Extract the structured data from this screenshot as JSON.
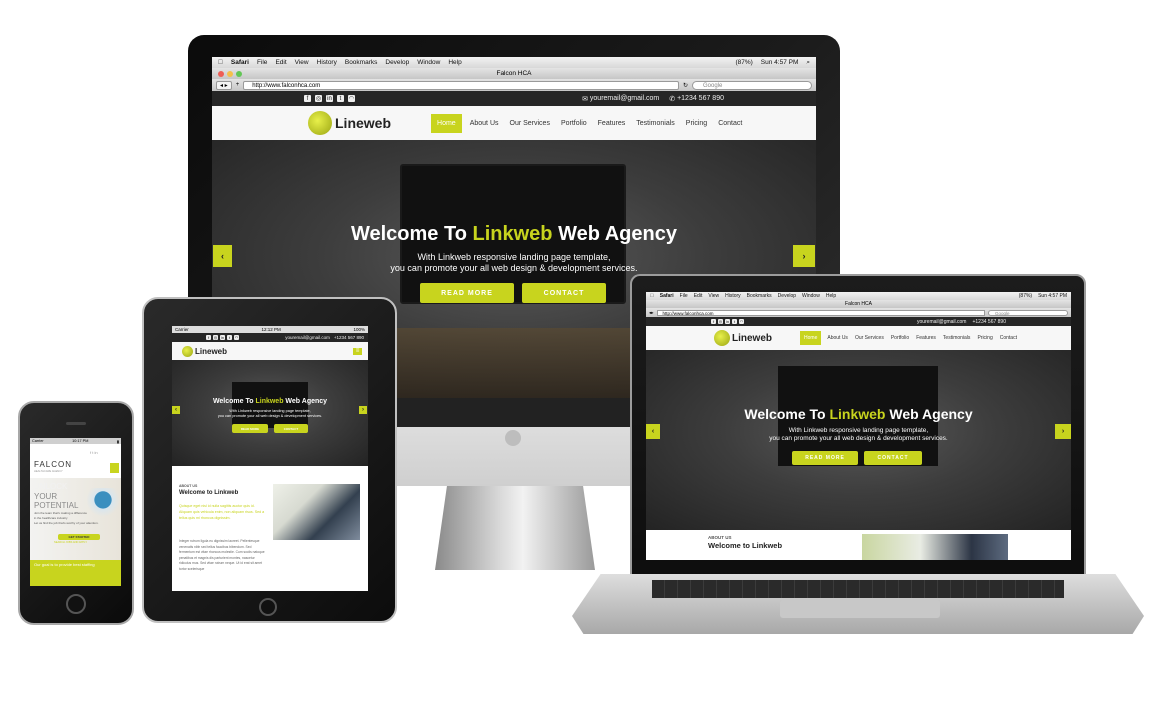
{
  "colors": {
    "accent": "#c8d41e",
    "dark": "#262626",
    "frame": "#111111"
  },
  "mac_menu": {
    "apple": "",
    "items": [
      "Safari",
      "File",
      "Edit",
      "View",
      "History",
      "Bookmarks",
      "Develop",
      "Window",
      "Help"
    ],
    "battery": "(87%)",
    "clock": "Sun 4:57 PM"
  },
  "browser": {
    "window_title": "Falcon HCA",
    "url": "http://www.falconhca.com",
    "search_placeholder": "Google"
  },
  "site": {
    "email": "youremail@gmail.com",
    "phone": "+1234 567 890",
    "logo_text": "Lineweb",
    "nav": [
      "Home",
      "About Us",
      "Our Services",
      "Portfolio",
      "Features",
      "Testimonials",
      "Pricing",
      "Contact"
    ],
    "hero_prefix": "Welcome To ",
    "hero_brand": "Linkweb",
    "hero_suffix": " Web Agency",
    "hero_sub1": "With Linkweb responsive landing page template,",
    "hero_sub2": "you can promote your all web design & development services.",
    "read_more": "READ MORE",
    "contact": "CONTACT",
    "about_kicker": "ABOUT US",
    "about_title": "Welcome to Linkweb",
    "about_highlight": "Quisque eget nisl id nulla sagittis auctor quis id. Aliquam quis vehicula enim, non aliquam risus. Sed a tellus quis mi rhoncus dignissim.",
    "about_body": "Integer rutrum ligula eu dignissim laoreet. Pellentesque venenatis nibh sed tellus faucibus bibendum. Sed fermentum est vitae rhoncus molestie. Cum sociis natoque penatibus et magnis dis parturient montes, nascetur ridiculus mus. Sed vitae rutrum neque. Ut id erat sit amet tortor scelerisque"
  },
  "tablet": {
    "carrier": "Carrier",
    "time": "12:12 PM",
    "battery": "100%"
  },
  "phone": {
    "carrier": "Carrier",
    "time": "10:17 PM",
    "brand": "FALCON",
    "tagline": "HEALTHCARE AGENCY",
    "hero_a": "UNLOCK",
    "hero_b": "YOUR",
    "hero_c": "POTENTIAL",
    "body": "Join the team that's making a difference in the healthcare industry",
    "body2": "Let us find the job that's worthy of your attention.",
    "cta": "GET STARTED",
    "cta2": "SEARCH JOBS AND APPLY",
    "footer_text": "Our goal is to provide best staffing"
  }
}
